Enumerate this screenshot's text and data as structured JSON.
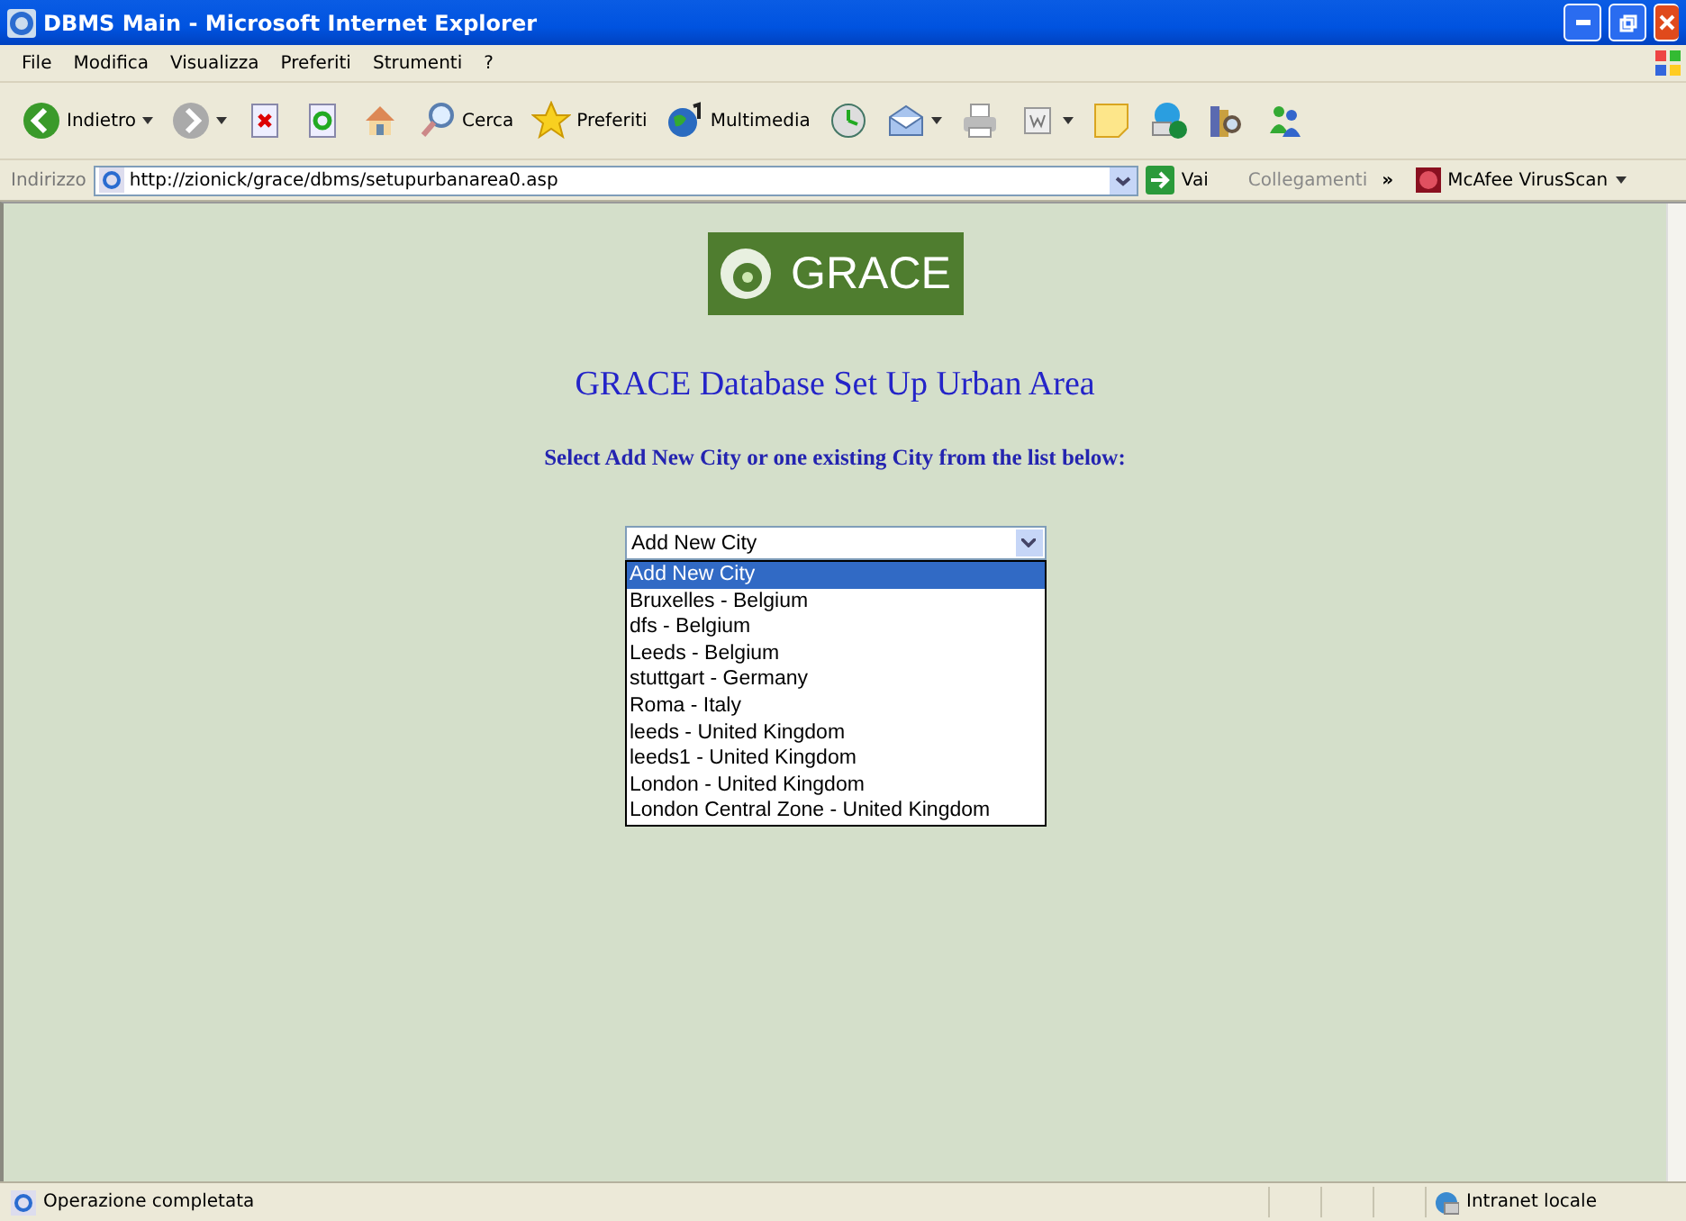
{
  "window": {
    "title": "DBMS Main - Microsoft Internet Explorer"
  },
  "menu": [
    {
      "label": "File"
    },
    {
      "label": "Modifica"
    },
    {
      "label": "Visualizza"
    },
    {
      "label": "Preferiti"
    },
    {
      "label": "Strumenti"
    },
    {
      "label": "?"
    }
  ],
  "toolbar": [
    {
      "kind": "back",
      "label": "Indietro"
    },
    {
      "kind": "forward"
    },
    {
      "kind": "stop"
    },
    {
      "kind": "refresh"
    },
    {
      "kind": "home"
    },
    {
      "kind": "search",
      "label": "Cerca"
    },
    {
      "kind": "favorites",
      "label": "Preferiti"
    },
    {
      "kind": "media",
      "label": "Multimedia"
    },
    {
      "kind": "history"
    },
    {
      "kind": "mail"
    },
    {
      "kind": "print"
    },
    {
      "kind": "edit"
    },
    {
      "kind": "note"
    },
    {
      "kind": "phone"
    },
    {
      "kind": "research"
    },
    {
      "kind": "messenger"
    }
  ],
  "address_bar": {
    "label": "Indirizzo",
    "url": "http://zionick/grace/dbms/setupurbanarea0.asp",
    "go": "Vai",
    "links": "Collegamenti",
    "links_more": "»",
    "extension": "McAfee VirusScan"
  },
  "page": {
    "logo": "GRACE",
    "heading": "GRACE Database Set Up Urban Area",
    "instruction": "Select Add New City or one existing City from the list below:",
    "city_select": {
      "value": "Add New City",
      "expanded": true,
      "options": [
        {
          "label": "Add New City",
          "selected": true
        },
        {
          "label": "Bruxelles - Belgium",
          "selected": false
        },
        {
          "label": "dfs - Belgium",
          "selected": false
        },
        {
          "label": "Leeds - Belgium",
          "selected": false
        },
        {
          "label": "stuttgart - Germany",
          "selected": false
        },
        {
          "label": "Roma - Italy",
          "selected": false
        },
        {
          "label": "leeds - United Kingdom",
          "selected": false
        },
        {
          "label": "leeds1 - United Kingdom",
          "selected": false
        },
        {
          "label": "London - United Kingdom",
          "selected": false
        },
        {
          "label": "London Central Zone - United Kingdom",
          "selected": false
        }
      ]
    }
  },
  "status_bar": {
    "text": "Operazione completata",
    "zone": "Intranet locale"
  }
}
